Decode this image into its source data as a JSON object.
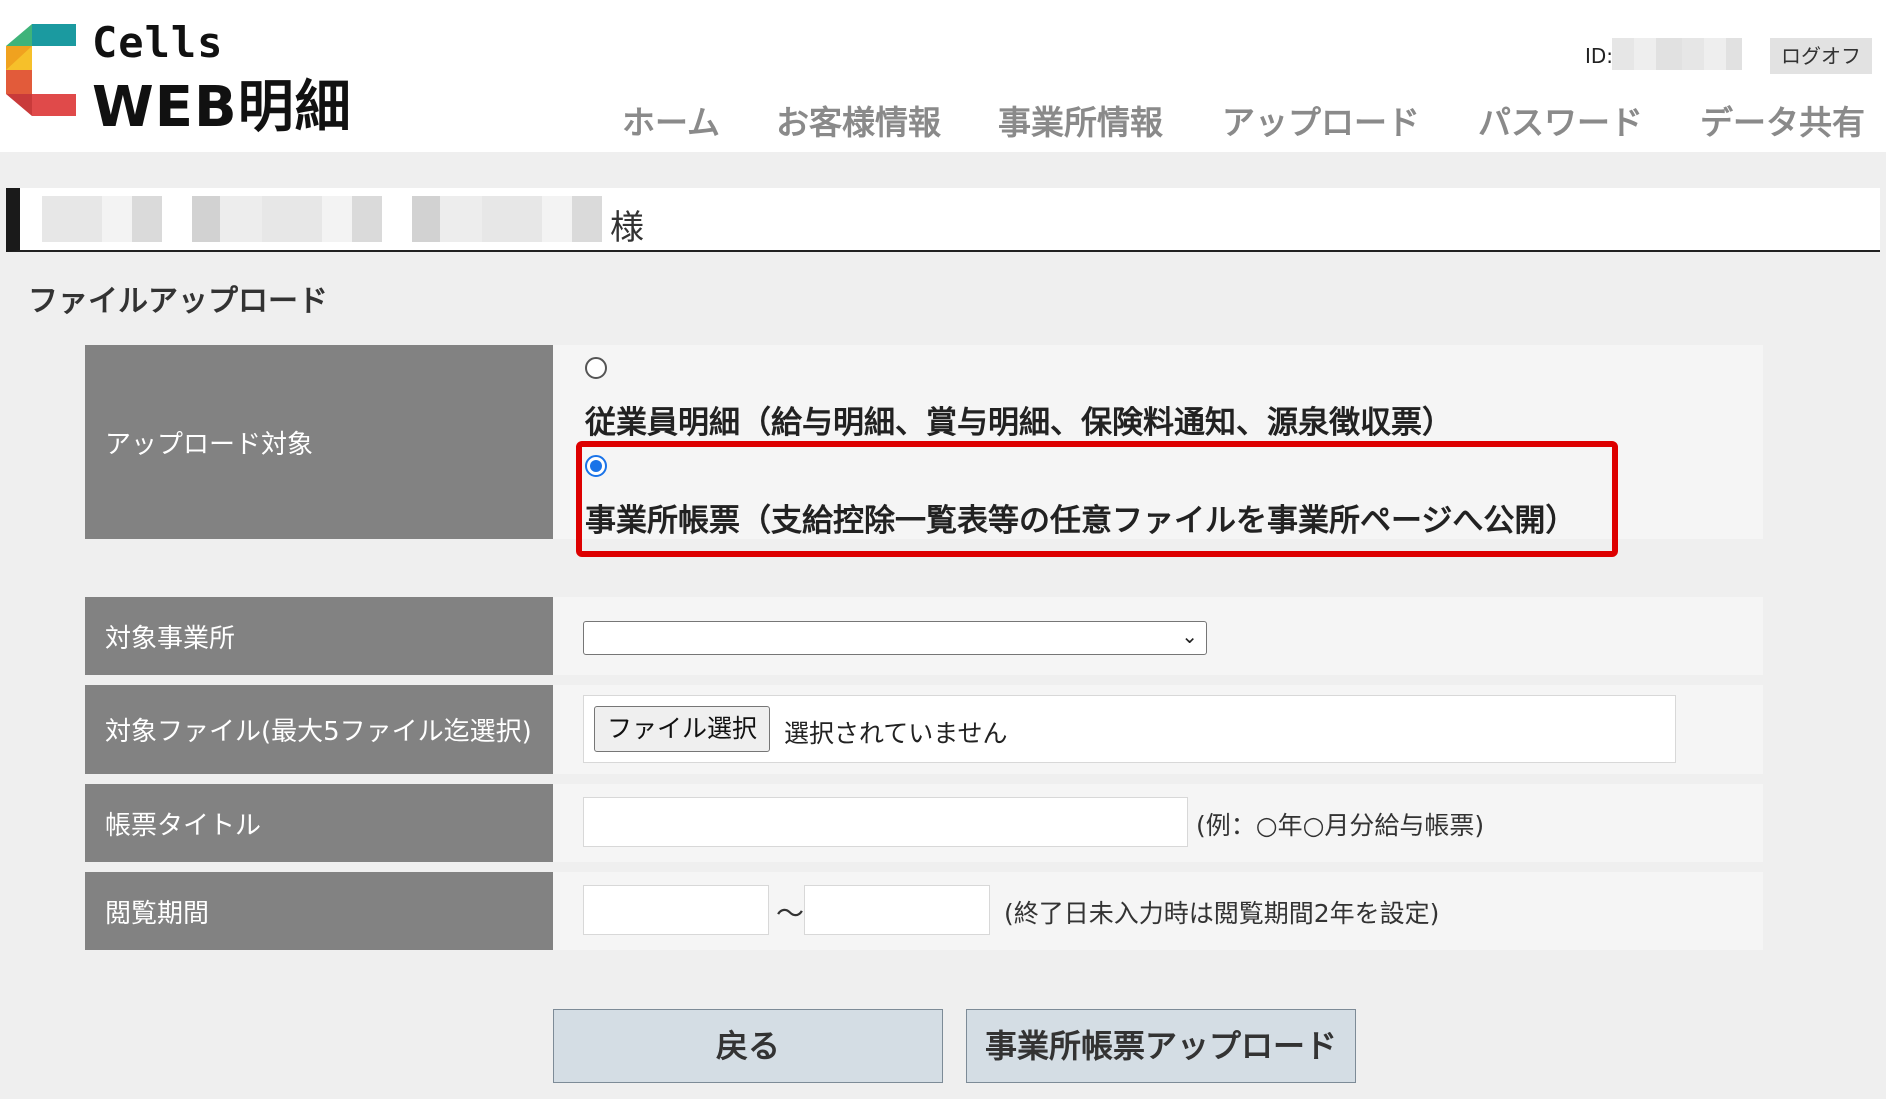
{
  "header": {
    "brand_top": "Cells",
    "brand_main": "WEB明細",
    "id_label": "ID:",
    "logoff_label": "ログオフ",
    "nav": [
      {
        "label": "ホーム"
      },
      {
        "label": "お客様情報"
      },
      {
        "label": "事業所情報"
      },
      {
        "label": "アップロード"
      },
      {
        "label": "パスワード"
      },
      {
        "label": "データ共有"
      }
    ]
  },
  "customer": {
    "suffix": "様"
  },
  "page_title": "ファイルアップロード",
  "form": {
    "upload_target": {
      "label": "アップロード対象",
      "options": [
        {
          "label": "従業員明細（給与明細、賞与明細、保険料通知、源泉徴収票）",
          "selected": false
        },
        {
          "label": "事業所帳票（支給控除一覧表等の任意ファイルを事業所ページへ公開）",
          "selected": true
        }
      ]
    },
    "office": {
      "label": "対象事業所",
      "selected_value": ""
    },
    "file": {
      "label": "対象ファイル(最大5ファイル迄選択)",
      "button_label": "ファイル選択",
      "status_text": "選択されていません"
    },
    "title": {
      "label": "帳票タイトル",
      "value": "",
      "hint": "(例：○年○月分給与帳票)"
    },
    "period": {
      "label": "閲覧期間",
      "from_value": "",
      "separator": "～",
      "to_value": "",
      "hint": "(終了日未入力時は閲覧期間2年を設定)"
    }
  },
  "buttons": {
    "back_label": "戻る",
    "upload_label": "事業所帳票アップロード"
  },
  "colors": {
    "label_bg": "#828282",
    "highlight": "#dd0000",
    "radio_selected": "#1a73e8",
    "nav_text": "#8a8a8a",
    "button_bg": "#d4dde4"
  }
}
